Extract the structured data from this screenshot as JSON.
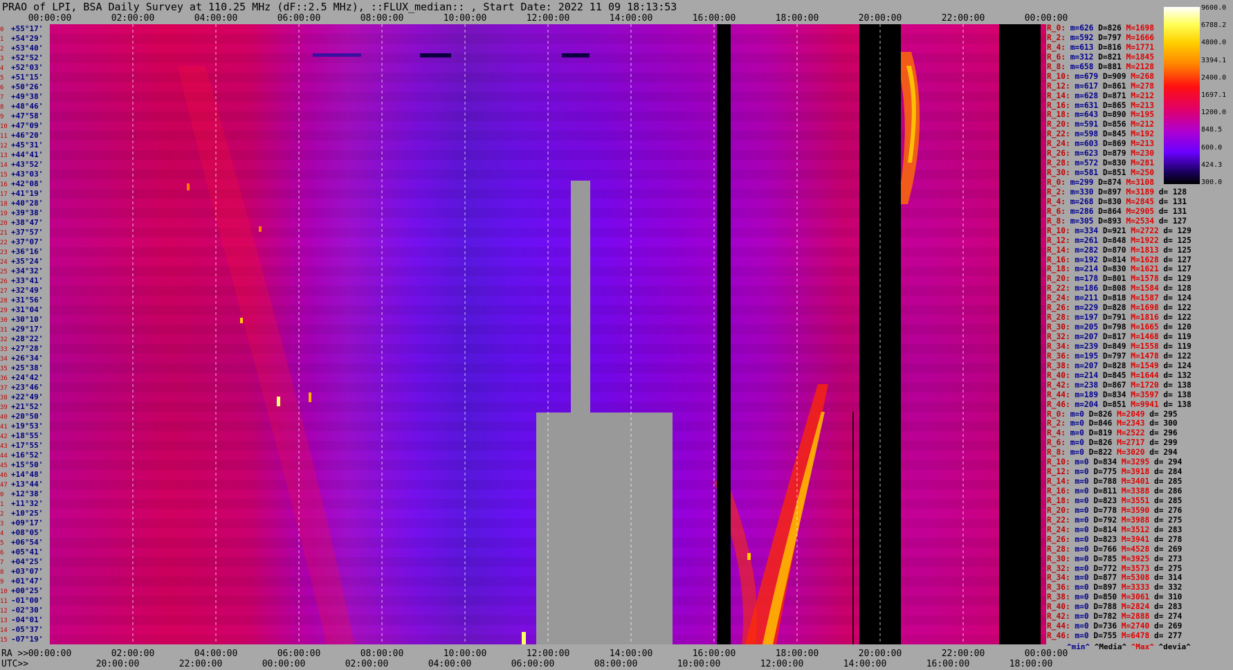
{
  "title": "PRAO of LPI, BSA Daily Survey at 110.25 MHz (dF::2.5 MHz), ::FLUX_median:: , Start Date: 2022 11 09 18:13:53",
  "axes": {
    "top_ticks": [
      "00:00:00",
      "02:00:00",
      "04:00:00",
      "06:00:00",
      "08:00:00",
      "10:00:00",
      "12:00:00",
      "14:00:00",
      "16:00:00",
      "18:00:00",
      "20:00:00",
      "22:00:00",
      "00:00:00"
    ],
    "ra_prefix": "RA >>",
    "ra_ticks": [
      "00:00:00",
      "02:00:00",
      "04:00:00",
      "06:00:00",
      "08:00:00",
      "10:00:00",
      "12:00:00",
      "14:00:00",
      "16:00:00",
      "18:00:00",
      "20:00:00",
      "22:00:00",
      "00:00:00"
    ],
    "utc_prefix": "UTC>>",
    "utc_ticks": [
      "20:00:00",
      "22:00:00",
      "00:00:00",
      "02:00:00",
      "04:00:00",
      "06:00:00",
      "08:00:00",
      "10:00:00",
      "12:00:00",
      "14:00:00",
      "16:00:00",
      "18:00:00"
    ]
  },
  "declinations": [
    "+55°17'",
    "+54°29'",
    "+53°40'",
    "+52°52'",
    "+52°03'",
    "+51°15'",
    "+50°26'",
    "+49°38'",
    "+48°46'",
    "+47°58'",
    "+47°09'",
    "+46°20'",
    "+45°31'",
    "+44°41'",
    "+43°52'",
    "+43°03'",
    "+42°08'",
    "+41°19'",
    "+40°28'",
    "+39°38'",
    "+38°47'",
    "+37°57'",
    "+37°07'",
    "+36°16'",
    "+35°24'",
    "+34°32'",
    "+33°41'",
    "+32°49'",
    "+31°56'",
    "+31°04'",
    "+30°10'",
    "+29°17'",
    "+28°22'",
    "+27°28'",
    "+26°34'",
    "+25°38'",
    "+24°42'",
    "+23°46'",
    "+22°49'",
    "+21°52'",
    "+20°50'",
    "+19°53'",
    "+18°55'",
    "+17°55'",
    "+16°52'",
    "+15°50'",
    "+14°48'",
    "+13°44'",
    "+12°38'",
    "+11°32'",
    "+10°25'",
    "+09°17'",
    "+08°05'",
    "+06°54'",
    "+05°41'",
    "+04°25'",
    "+03°07'",
    "+01°47'",
    "+00°25'",
    "-01°00'",
    "-02°30'",
    "-04°01'",
    "-05°37'",
    "-07°19'"
  ],
  "colorbar": {
    "labels": [
      "9600.0",
      "6788.2",
      "4800.0",
      "3394.1",
      "2400.0",
      "1697.1",
      "1200.0",
      "848.5",
      "600.0",
      "424.3",
      "300.0"
    ],
    "colors": [
      "#ffffff",
      "#ffff55",
      "#ffd000",
      "#ff8800",
      "#ff1010",
      "#e0006a",
      "#b000d0",
      "#6a00ff",
      "#1a0060",
      "#000000"
    ]
  },
  "stats": [
    {
      "label": "R_0:",
      "min": "626",
      "med": "826",
      "max": "1698",
      "dev": ""
    },
    {
      "label": "R_2:",
      "min": "592",
      "med": "797",
      "max": "1666",
      "dev": ""
    },
    {
      "label": "R_4:",
      "min": "613",
      "med": "816",
      "max": "1771",
      "dev": ""
    },
    {
      "label": "R_6:",
      "min": "312",
      "med": "821",
      "max": "1845",
      "dev": ""
    },
    {
      "label": "R_8:",
      "min": "658",
      "med": "881",
      "max": "2128",
      "dev": ""
    },
    {
      "label": "R_10:",
      "min": "679",
      "med": "909",
      "max": "268",
      "dev": ""
    },
    {
      "label": "R_12:",
      "min": "617",
      "med": "861",
      "max": "278",
      "dev": ""
    },
    {
      "label": "R_14:",
      "min": "628",
      "med": "871",
      "max": "212",
      "dev": ""
    },
    {
      "label": "R_16:",
      "min": "631",
      "med": "865",
      "max": "213",
      "dev": ""
    },
    {
      "label": "R_18:",
      "min": "643",
      "med": "890",
      "max": "195",
      "dev": ""
    },
    {
      "label": "R_20:",
      "min": "591",
      "med": "856",
      "max": "212",
      "dev": ""
    },
    {
      "label": "R_22:",
      "min": "598",
      "med": "845",
      "max": "192",
      "dev": ""
    },
    {
      "label": "R_24:",
      "min": "603",
      "med": "869",
      "max": "213",
      "dev": ""
    },
    {
      "label": "R_26:",
      "min": "623",
      "med": "879",
      "max": "230",
      "dev": ""
    },
    {
      "label": "R_28:",
      "min": "572",
      "med": "830",
      "max": "281",
      "dev": ""
    },
    {
      "label": "R_30:",
      "min": "581",
      "med": "851",
      "max": "250",
      "dev": ""
    },
    {
      "label": "R_0:",
      "min": "299",
      "med": "874",
      "max": "3108",
      "dev": ""
    },
    {
      "label": "R_2:",
      "min": "330",
      "med": "897",
      "max": "3189",
      "dev": "128"
    },
    {
      "label": "R_4:",
      "min": "268",
      "med": "830",
      "max": "2845",
      "dev": "131"
    },
    {
      "label": "R_6:",
      "min": "286",
      "med": "864",
      "max": "2905",
      "dev": "131"
    },
    {
      "label": "R_8:",
      "min": "305",
      "med": "893",
      "max": "2534",
      "dev": "127"
    },
    {
      "label": "R_10:",
      "min": "334",
      "med": "921",
      "max": "2722",
      "dev": "129"
    },
    {
      "label": "R_12:",
      "min": "261",
      "med": "848",
      "max": "1922",
      "dev": "125"
    },
    {
      "label": "R_14:",
      "min": "282",
      "med": "870",
      "max": "1813",
      "dev": "125"
    },
    {
      "label": "R_16:",
      "min": "192",
      "med": "814",
      "max": "1628",
      "dev": "127"
    },
    {
      "label": "R_18:",
      "min": "214",
      "med": "830",
      "max": "1621",
      "dev": "127"
    },
    {
      "label": "R_20:",
      "min": "178",
      "med": "801",
      "max": "1578",
      "dev": "129"
    },
    {
      "label": "R_22:",
      "min": "186",
      "med": "808",
      "max": "1584",
      "dev": "128"
    },
    {
      "label": "R_24:",
      "min": "211",
      "med": "818",
      "max": "1587",
      "dev": "124"
    },
    {
      "label": "R_26:",
      "min": "229",
      "med": "828",
      "max": "1698",
      "dev": "122"
    },
    {
      "label": "R_28:",
      "min": "197",
      "med": "791",
      "max": "1816",
      "dev": "122"
    },
    {
      "label": "R_30:",
      "min": "205",
      "med": "798",
      "max": "1665",
      "dev": "120"
    },
    {
      "label": "R_32:",
      "min": "207",
      "med": "817",
      "max": "1468",
      "dev": "119"
    },
    {
      "label": "R_34:",
      "min": "239",
      "med": "849",
      "max": "1558",
      "dev": "119"
    },
    {
      "label": "R_36:",
      "min": "195",
      "med": "797",
      "max": "1478",
      "dev": "122"
    },
    {
      "label": "R_38:",
      "min": "207",
      "med": "828",
      "max": "1549",
      "dev": "124"
    },
    {
      "label": "R_40:",
      "min": "214",
      "med": "845",
      "max": "1644",
      "dev": "132"
    },
    {
      "label": "R_42:",
      "min": "238",
      "med": "867",
      "max": "1720",
      "dev": "138"
    },
    {
      "label": "R_44:",
      "min": "189",
      "med": "834",
      "max": "3597",
      "dev": "138"
    },
    {
      "label": "R_46:",
      "min": "204",
      "med": "851",
      "max": "9941",
      "dev": "138"
    },
    {
      "label": "R_0:",
      "min": "0",
      "med": "826",
      "max": "2049",
      "dev": "295"
    },
    {
      "label": "R_2:",
      "min": "0",
      "med": "846",
      "max": "2343",
      "dev": "300"
    },
    {
      "label": "R_4:",
      "min": "0",
      "med": "819",
      "max": "2522",
      "dev": "296"
    },
    {
      "label": "R_6:",
      "min": "0",
      "med": "826",
      "max": "2717",
      "dev": "299"
    },
    {
      "label": "R_8:",
      "min": "0",
      "med": "822",
      "max": "3020",
      "dev": "294"
    },
    {
      "label": "R_10:",
      "min": "0",
      "med": "834",
      "max": "3295",
      "dev": "294"
    },
    {
      "label": "R_12:",
      "min": "0",
      "med": "775",
      "max": "3918",
      "dev": "284"
    },
    {
      "label": "R_14:",
      "min": "0",
      "med": "788",
      "max": "3401",
      "dev": "285"
    },
    {
      "label": "R_16:",
      "min": "0",
      "med": "811",
      "max": "3388",
      "dev": "286"
    },
    {
      "label": "R_18:",
      "min": "0",
      "med": "823",
      "max": "3551",
      "dev": "285"
    },
    {
      "label": "R_20:",
      "min": "0",
      "med": "778",
      "max": "3590",
      "dev": "276"
    },
    {
      "label": "R_22:",
      "min": "0",
      "med": "792",
      "max": "3988",
      "dev": "275"
    },
    {
      "label": "R_24:",
      "min": "0",
      "med": "814",
      "max": "3512",
      "dev": "283"
    },
    {
      "label": "R_26:",
      "min": "0",
      "med": "823",
      "max": "3941",
      "dev": "278"
    },
    {
      "label": "R_28:",
      "min": "0",
      "med": "766",
      "max": "4528",
      "dev": "269"
    },
    {
      "label": "R_30:",
      "min": "0",
      "med": "785",
      "max": "3925",
      "dev": "273"
    },
    {
      "label": "R_32:",
      "min": "0",
      "med": "772",
      "max": "3573",
      "dev": "275"
    },
    {
      "label": "R_34:",
      "min": "0",
      "med": "877",
      "max": "5308",
      "dev": "314"
    },
    {
      "label": "R_36:",
      "min": "0",
      "med": "897",
      "max": "3333",
      "dev": "332"
    },
    {
      "label": "R_38:",
      "min": "0",
      "med": "850",
      "max": "3061",
      "dev": "310"
    },
    {
      "label": "R_40:",
      "min": "0",
      "med": "788",
      "max": "2824",
      "dev": "283"
    },
    {
      "label": "R_42:",
      "min": "0",
      "med": "782",
      "max": "2888",
      "dev": "274"
    },
    {
      "label": "R_44:",
      "min": "0",
      "med": "736",
      "max": "2740",
      "dev": "269"
    },
    {
      "label": "R_46:",
      "min": "0",
      "med": "755",
      "max": "6478",
      "dev": "277"
    }
  ],
  "stats_footer": {
    "min": "^min^",
    "med": "^Media^",
    "max": "^Max^",
    "dev": "^devia^"
  },
  "chart_data": {
    "type": "heatmap",
    "title": "PRAO of LPI, BSA Daily Survey at 110.25 MHz (dF::2.5 MHz), ::FLUX_median:: , Start Date: 2022 11 09 18:13:53",
    "x_axis": "RA 00:00:00 – 00:00:00 (24 h)",
    "y_axis": "Declination +55°17' … -07°19'",
    "color_scale_range": [
      300.0,
      9600.0
    ],
    "color_scale": "log",
    "grid": "dashed vertical lines every 2 h",
    "row_labels_count": 64
  }
}
